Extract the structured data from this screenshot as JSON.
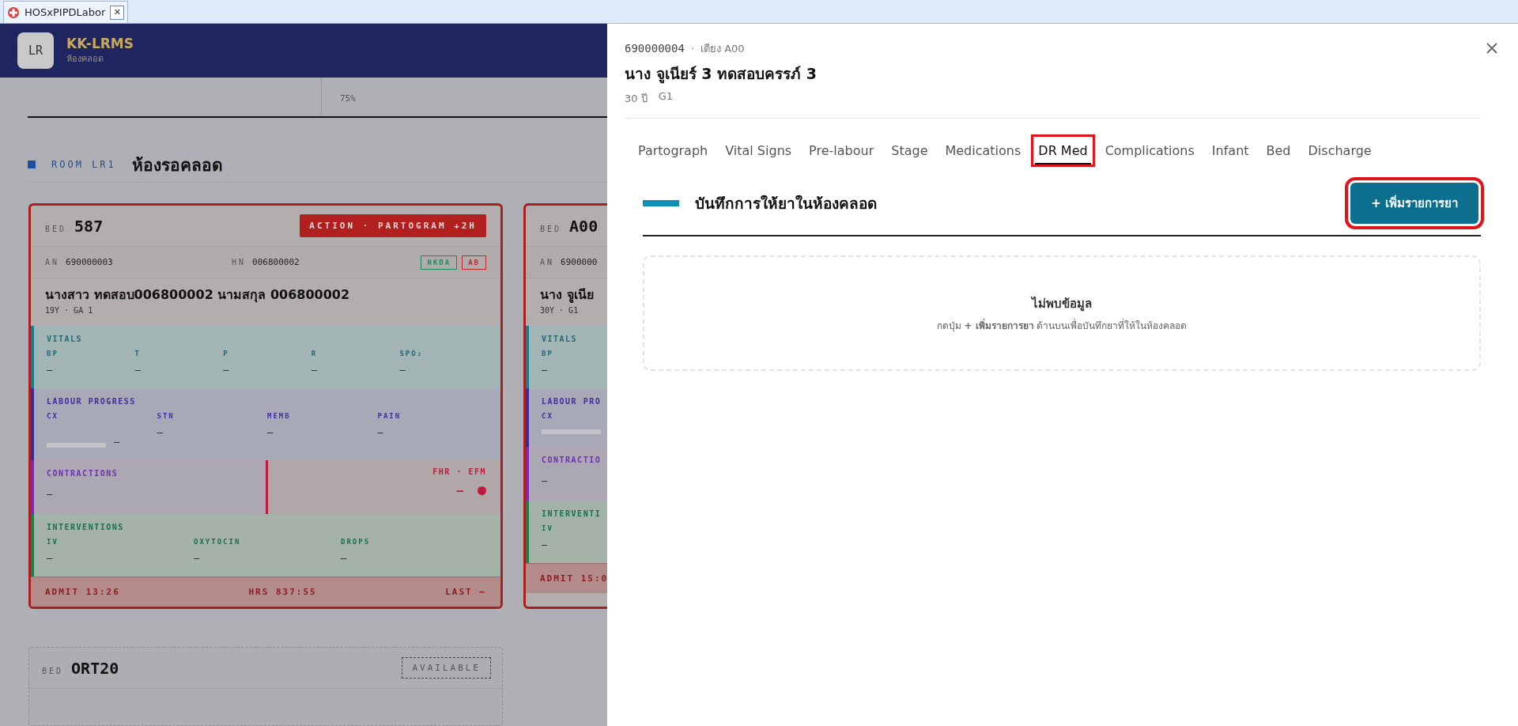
{
  "app_tab": {
    "title": "HOSxPIPDLabor",
    "close": "✕"
  },
  "header": {
    "logo": "LR",
    "title": "KK-LRMS",
    "subtitle": "ห้องคลอด"
  },
  "stats_strip": {
    "value": "75%"
  },
  "room": {
    "code": "ROOM LR1",
    "name": "ห้องรอคลอด"
  },
  "beds": [
    {
      "kind": "occupied",
      "bed_label": "BED",
      "bed": "587",
      "alert": "ACTION · PARTOGRAM +2H",
      "an_label": "AN",
      "an": "690000003",
      "hn_label": "HN",
      "hn": "006800002",
      "tags": [
        {
          "label": "NKDA",
          "color": "#1e8a5a"
        },
        {
          "label": "AB",
          "color": "#c0282c"
        }
      ],
      "name": "นางสาว ทดสอบ006800002 นามสกุล 006800002",
      "meta": "19Y · GA 1",
      "vitals": {
        "title": "VITALS",
        "fields": [
          {
            "label": "BP",
            "value": "—"
          },
          {
            "label": "T",
            "value": "—"
          },
          {
            "label": "P",
            "value": "—"
          },
          {
            "label": "R",
            "value": "—"
          },
          {
            "label": "SPO₂",
            "value": "—"
          }
        ]
      },
      "labour": {
        "title": "LABOUR PROGRESS",
        "fields": [
          {
            "label": "CX",
            "value": "—",
            "level": 0
          },
          {
            "label": "STN",
            "value": "—"
          },
          {
            "label": "MEMB",
            "value": "—"
          },
          {
            "label": "PAIN",
            "value": "—"
          }
        ]
      },
      "contractions": {
        "title": "CONTRACTIONS",
        "value": "—"
      },
      "fhr": {
        "title": "FHR · EFM",
        "value": "—"
      },
      "interventions": {
        "title": "INTERVENTIONS",
        "fields": [
          {
            "label": "IV",
            "value": "—"
          },
          {
            "label": "OXYTOCIN",
            "value": "—"
          },
          {
            "label": "DROPS",
            "value": "—"
          }
        ]
      },
      "footer": {
        "admit": "ADMIT 13:26",
        "hrs": "HRS 837:55",
        "last": "LAST —"
      }
    },
    {
      "kind": "occupied",
      "bed_label": "BED",
      "bed": "A00",
      "an_label": "AN",
      "an": "6900000",
      "name": "นาง จูเนีย",
      "meta": "30Y · G1",
      "vitals": {
        "title": "VITALS",
        "fields": [
          {
            "label": "BP",
            "value": "—"
          }
        ]
      },
      "labour": {
        "title": "LABOUR PRO",
        "fields": [
          {
            "label": "CX",
            "level": 0
          }
        ]
      },
      "contractions": {
        "title": "CONTRACTIO",
        "value": "—"
      },
      "interventions": {
        "title": "INTERVENTI",
        "fields": [
          {
            "label": "IV",
            "value": "—"
          }
        ]
      },
      "footer": {
        "admit": "ADMIT 15:0"
      }
    },
    {
      "kind": "available",
      "bed_label": "BED",
      "bed": "ORT20",
      "status": "AVAILABLE"
    }
  ],
  "drawer": {
    "id": "690000004",
    "separator": "·",
    "bed": "เตียง A00",
    "name": "นาง จูเนียร์ 3 ทดสอบครรภ์ 3",
    "age": "30 ปี",
    "gravida": "G1",
    "tabs": [
      {
        "label": "Partograph",
        "selected": false,
        "highlighted": false
      },
      {
        "label": "Vital Signs",
        "selected": false,
        "highlighted": false
      },
      {
        "label": "Pre-labour",
        "selected": false,
        "highlighted": false
      },
      {
        "label": "Stage",
        "selected": false,
        "highlighted": false
      },
      {
        "label": "Medications",
        "selected": false,
        "highlighted": false
      },
      {
        "label": "DR Med",
        "selected": true,
        "highlighted": true
      },
      {
        "label": "Complications",
        "selected": false,
        "highlighted": false
      },
      {
        "label": "Infant",
        "selected": false,
        "highlighted": false
      },
      {
        "label": "Bed",
        "selected": false,
        "highlighted": false
      },
      {
        "label": "Discharge",
        "selected": false,
        "highlighted": false
      }
    ],
    "section": {
      "title": "บันทึกการให้ยาในห้องคลอด",
      "add_button": {
        "label": "+ เพิ่มรายการยา",
        "highlighted": true
      }
    },
    "empty": {
      "title": "ไม่พบข้อมูล",
      "hint": "กดปุ่ม **+ เพิ่มรายการยา** ด้านบนเพื่อบันทึกยาที่ให้ในห้องคลอด"
    }
  }
}
